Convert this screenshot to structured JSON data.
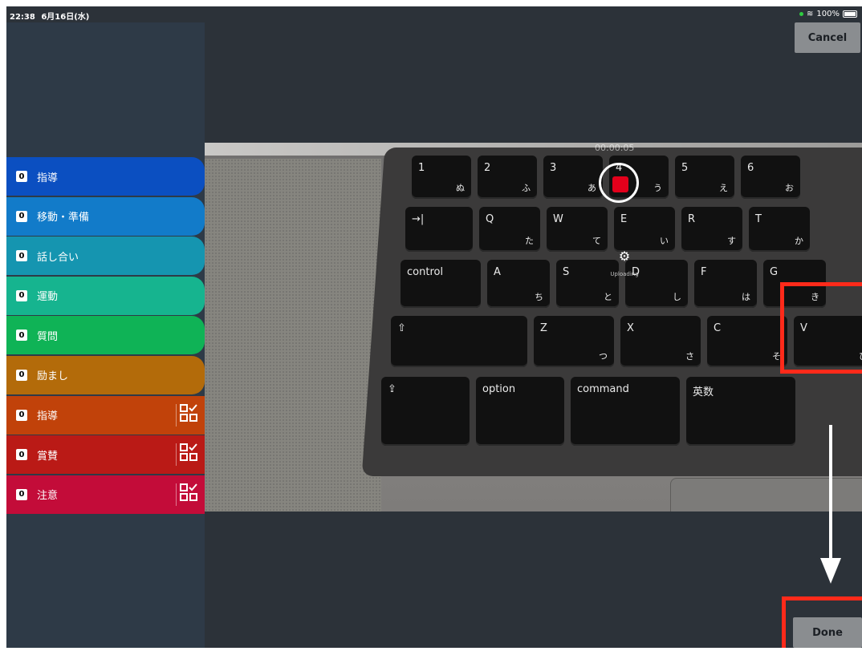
{
  "status_bar": {
    "time": "22:38",
    "date": "6月16日(水)",
    "battery": "100%"
  },
  "header": {
    "cancel_label": "Cancel"
  },
  "categories": [
    {
      "count": "0",
      "label": "指導",
      "color": "#0b4fc1",
      "has_qr": false
    },
    {
      "count": "0",
      "label": "移動・準備",
      "color": "#127bc9",
      "has_qr": false
    },
    {
      "count": "0",
      "label": "話し合い",
      "color": "#1595b0",
      "has_qr": false
    },
    {
      "count": "0",
      "label": "運動",
      "color": "#16b48f",
      "has_qr": false
    },
    {
      "count": "0",
      "label": "質問",
      "color": "#0fb356",
      "has_qr": false
    },
    {
      "count": "0",
      "label": "励まし",
      "color": "#b36b0a",
      "has_qr": false
    },
    {
      "count": "0",
      "label": "指導",
      "color": "#c1420a",
      "has_qr": true
    },
    {
      "count": "0",
      "label": "賞賛",
      "color": "#ba1a16",
      "has_qr": true
    },
    {
      "count": "0",
      "label": "注意",
      "color": "#c30c39",
      "has_qr": true
    }
  ],
  "recording": {
    "timer": "00:00:05",
    "upload_label": "Uploading",
    "accent": "#e3001b"
  },
  "footer": {
    "done_label": "Done"
  },
  "keyboard": {
    "row1": [
      [
        "1",
        "ぬ"
      ],
      [
        "2",
        "ふ"
      ],
      [
        "3",
        "あ"
      ],
      [
        "4",
        "う"
      ],
      [
        "5",
        "え"
      ],
      [
        "6",
        "お"
      ]
    ],
    "row2": [
      [
        "→|",
        ""
      ],
      [
        "Q",
        "た"
      ],
      [
        "W",
        "て"
      ],
      [
        "E",
        "い"
      ],
      [
        "R",
        "す"
      ],
      [
        "T",
        "か"
      ]
    ],
    "row3": [
      [
        "control",
        ""
      ],
      [
        "A",
        "ち"
      ],
      [
        "S",
        "と"
      ],
      [
        "D",
        "し"
      ],
      [
        "F",
        "は"
      ],
      [
        "G",
        "き"
      ]
    ],
    "row4": [
      [
        "⇧",
        ""
      ],
      [
        "Z",
        "つ"
      ],
      [
        "X",
        "さ"
      ],
      [
        "C",
        "そ"
      ],
      [
        "V",
        "ひ"
      ]
    ],
    "row5": [
      [
        "⇪",
        ""
      ],
      [
        "option",
        ""
      ],
      [
        "command",
        ""
      ],
      [
        "英数",
        ""
      ]
    ]
  }
}
